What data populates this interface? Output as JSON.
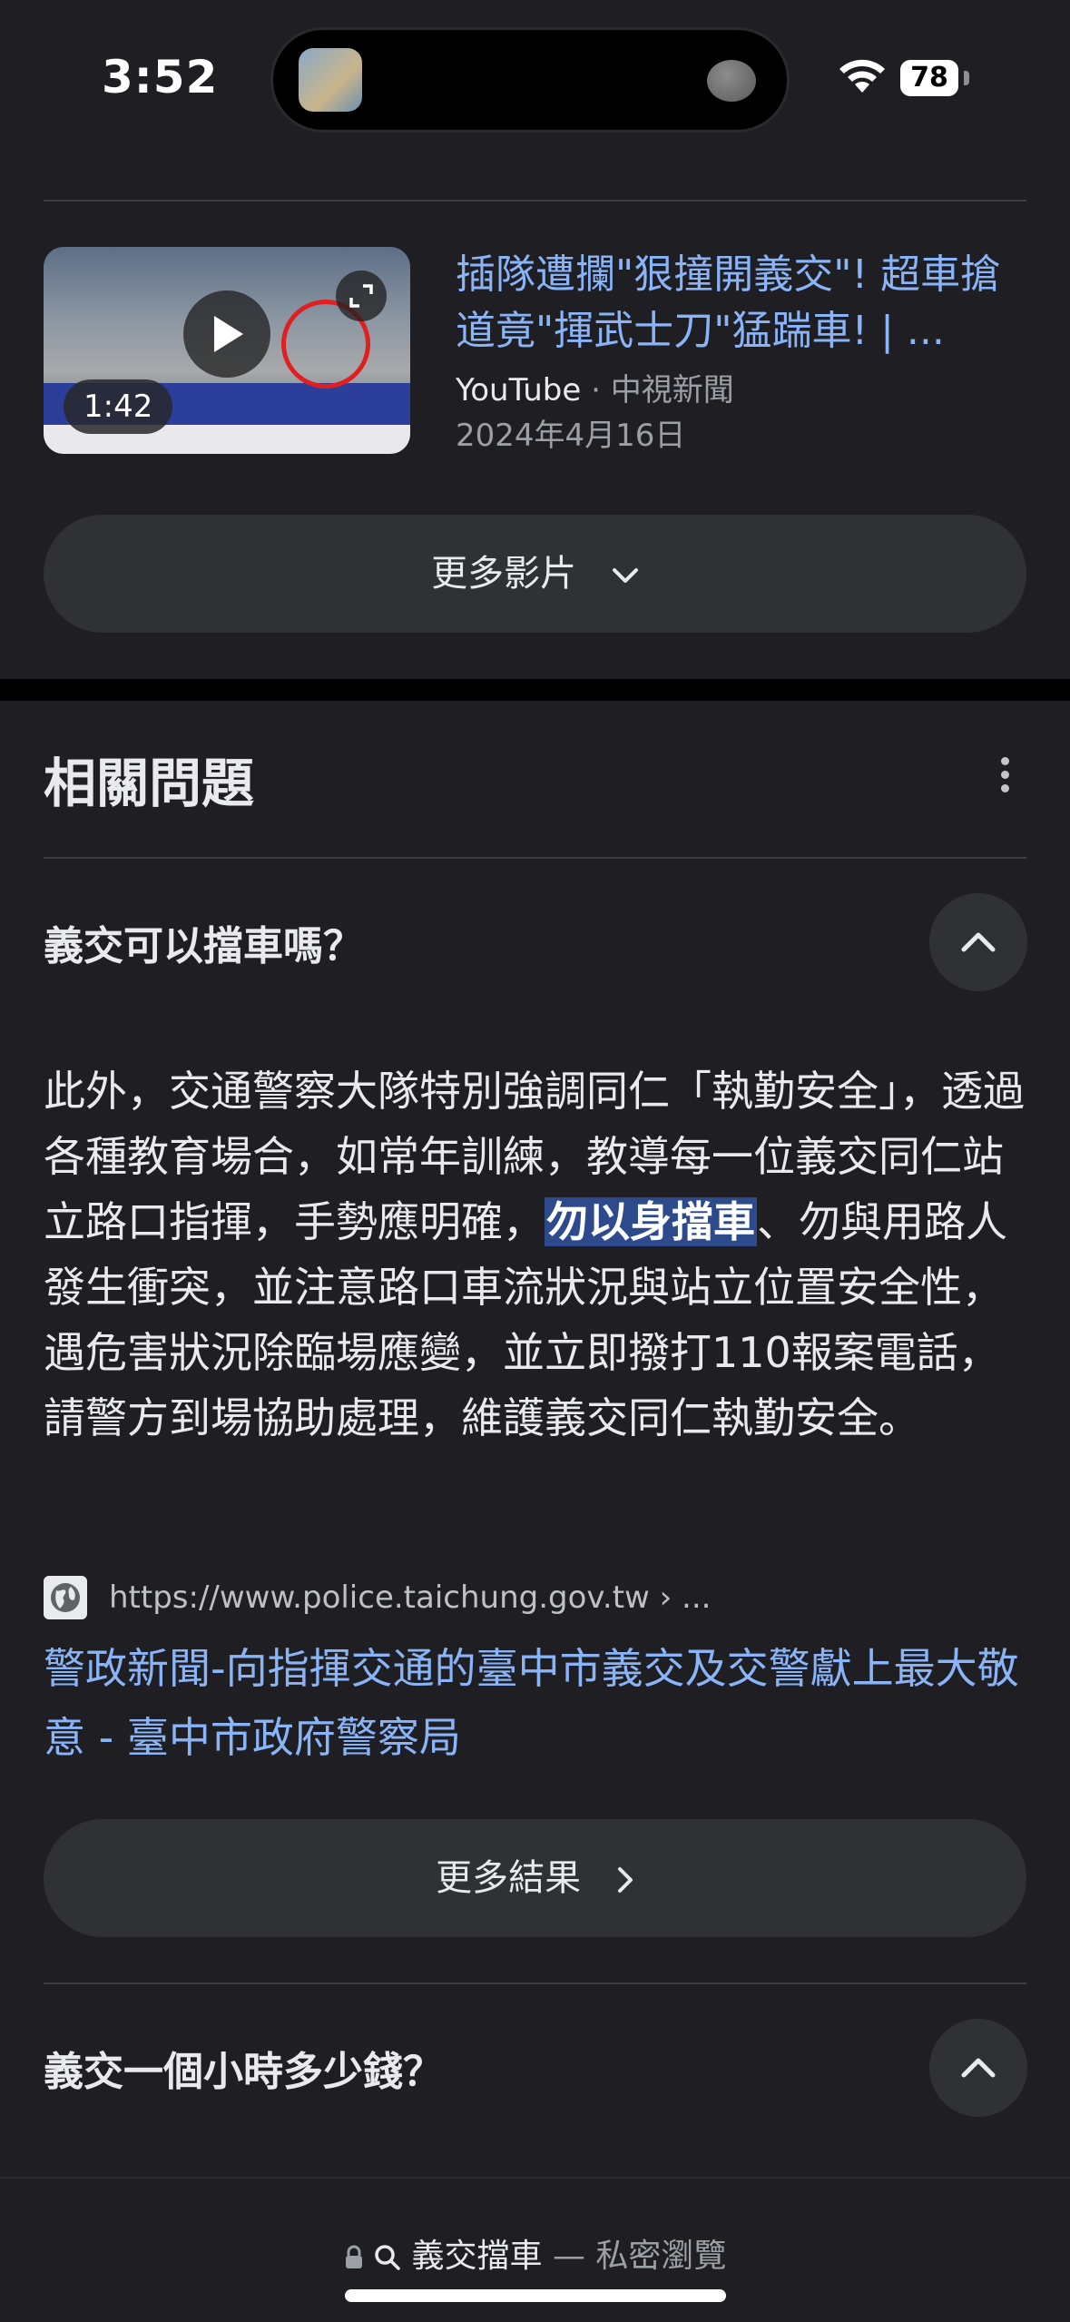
{
  "status_bar": {
    "time": "3:52",
    "battery": "78"
  },
  "video": {
    "duration": "1:42",
    "title": "插隊遭攔\"狠撞開義交\"! 超車搶道竟\"揮武士刀\"猛踹車! | ...",
    "source": "YouTube",
    "separator": " · ",
    "channel": "中視新聞",
    "date": "2024年4月16日"
  },
  "more_videos_label": "更多影片",
  "related": {
    "title": "相關問題",
    "q1": "義交可以擋車嗎？",
    "answer_part1": "此外，交通警察大隊特別強調同仁「執勤安全」，透過各種教育場合，如常年訓練，教導每一位義交同仁站立路口指揮，手勢應明確，",
    "answer_highlight": "勿以身擋車",
    "answer_part2": "、勿與用路人發生衝突，並注意路口車流狀況與站立位置安全性，遇危害狀況除臨場應變，並立即撥打110報案電話，請警方到場協助處理，維護義交同仁執勤安全。",
    "source_url": "https://www.police.taichung.gov.tw › ...",
    "source_title": "警政新聞-向指揮交通的臺中市義交及交警獻上最大敬意 - 臺中市政府警察局",
    "more_results_label": "更多結果",
    "q2": "義交一個小時多少錢？"
  },
  "bottom_bar": {
    "query": "義交擋車",
    "dash": " — ",
    "mode": "私密瀏覽"
  },
  "colors": {
    "link": "#8ab4f8",
    "background": "#1f1f23",
    "highlight": "#2c4a8c"
  }
}
